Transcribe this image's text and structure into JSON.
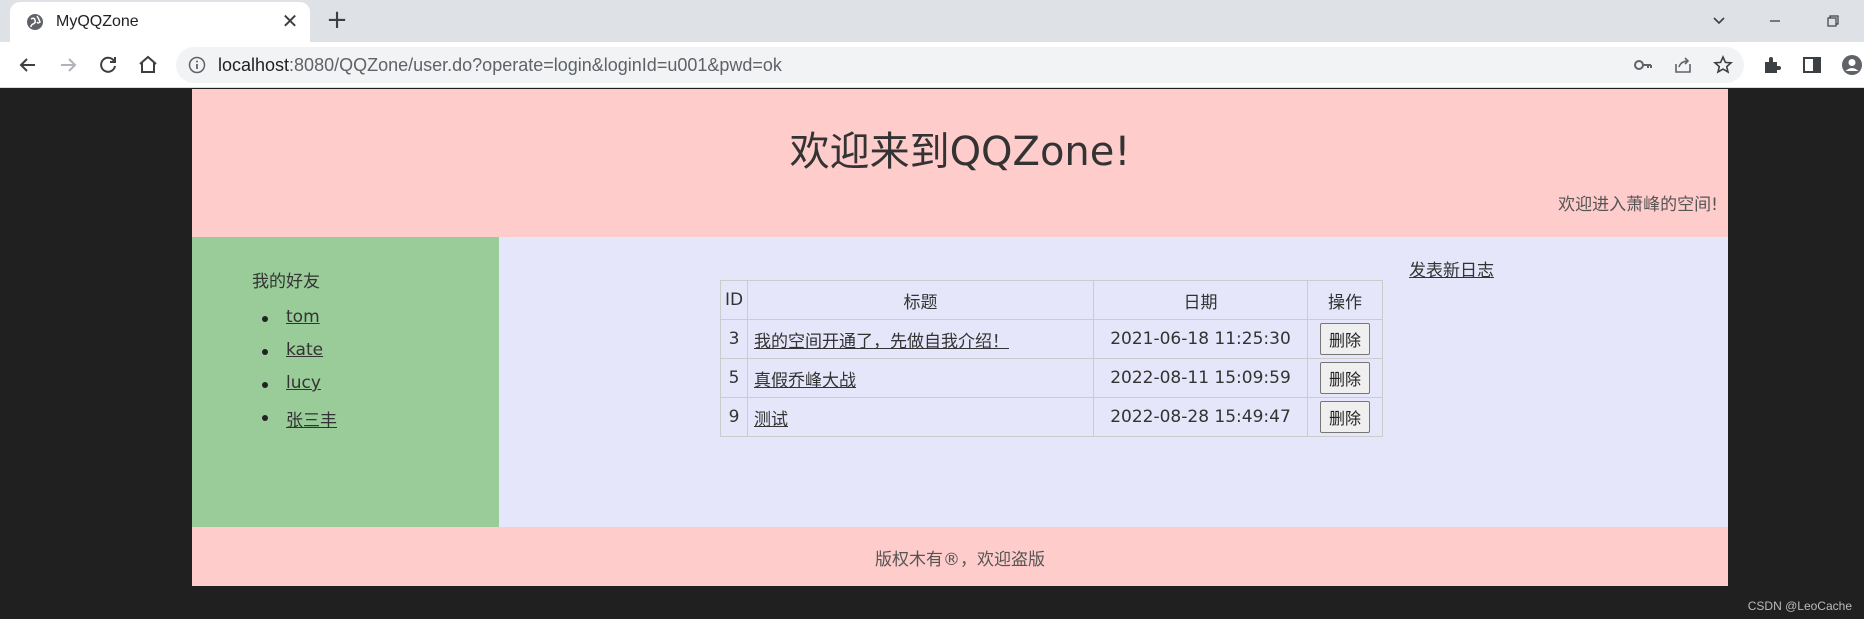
{
  "browser": {
    "tab_title": "MyQQZone",
    "tab_close": "✕",
    "new_tab": "+",
    "url_host": "localhost",
    "url_rest": ":8080/QQZone/user.do?operate=login&loginId=u001&pwd=ok"
  },
  "header": {
    "title": "欢迎来到QQZone!",
    "welcome": "欢迎进入萧峰的空间!"
  },
  "friends": {
    "title": "我的好友",
    "items": [
      {
        "name": "tom"
      },
      {
        "name": "kate"
      },
      {
        "name": "lucy"
      },
      {
        "name": "张三丰"
      }
    ]
  },
  "logs": {
    "new_post": "发表新日志",
    "columns": {
      "id": "ID",
      "title": "标题",
      "date": "日期",
      "action": "操作"
    },
    "rows": [
      {
        "id": "3",
        "title": "我的空间开通了，先做自我介绍！",
        "date": "2021-06-18 11:25:30",
        "action": "删除"
      },
      {
        "id": "5",
        "title": "真假乔峰大战",
        "date": "2022-08-11 15:09:59",
        "action": "删除"
      },
      {
        "id": "9",
        "title": "测试",
        "date": "2022-08-28 15:49:47",
        "action": "删除"
      }
    ]
  },
  "footer": {
    "text": "版权木有®，欢迎盗版"
  },
  "watermark": "CSDN @LeoCache",
  "colors": {
    "header_bg": "#ffcccc",
    "sidebar_bg": "#99cc99",
    "content_bg": "#e6e6fa",
    "outer_bg": "#202020"
  }
}
